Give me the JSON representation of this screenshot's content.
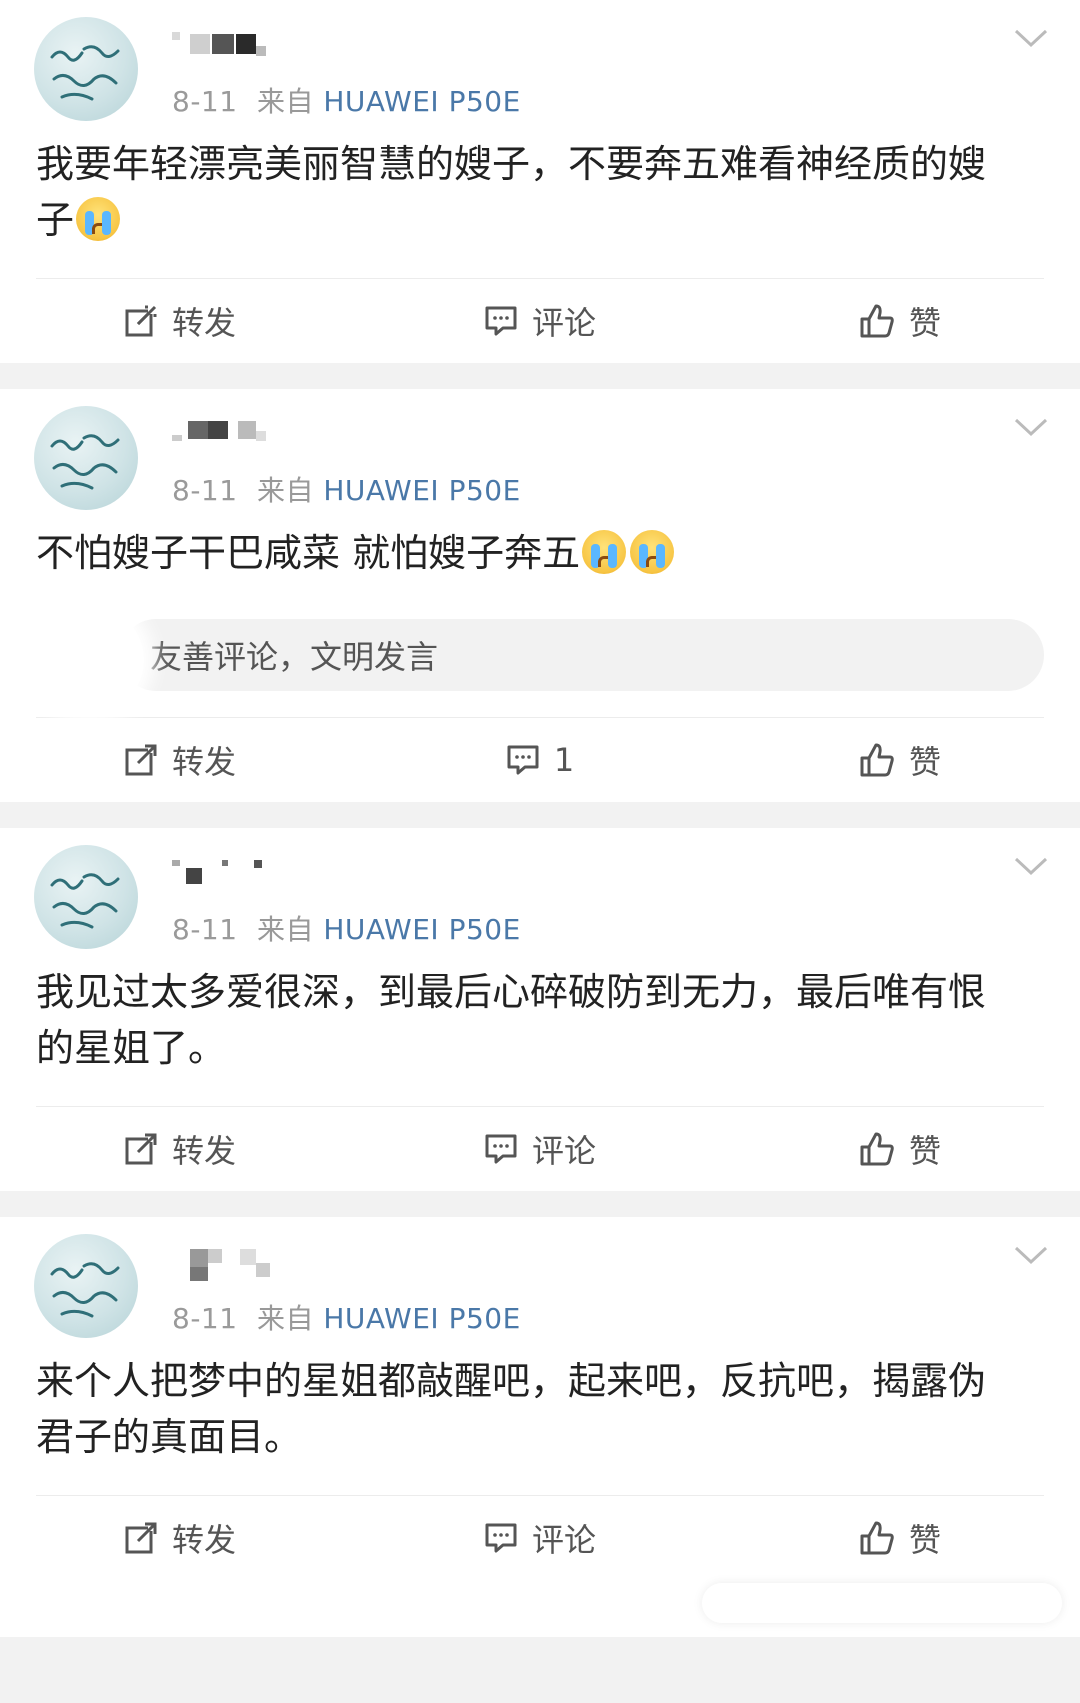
{
  "posts": [
    {
      "meta": {
        "date": "8-11",
        "via": "来自",
        "device": "HUAWEI P50E"
      },
      "content": [
        "我要年轻漂亮美丽智慧的嫂子，不要奔五难看神经质的嫂",
        "子"
      ],
      "emoji": [
        "crying-face-icon"
      ],
      "actions": {
        "repost": "转发",
        "comment": "评论",
        "like": "赞"
      }
    },
    {
      "meta": {
        "date": "8-11",
        "via": "来自",
        "device": "HUAWEI P50E"
      },
      "content": [
        "不怕嫂子干巴咸菜 就怕嫂子奔五"
      ],
      "emoji": [
        "crying-face-icon",
        "crying-face-icon"
      ],
      "comment_placeholder": "友善评论，文明发言",
      "actions": {
        "repost": "转发",
        "comment": "1",
        "like": "赞"
      }
    },
    {
      "meta": {
        "date": "8-11",
        "via": "来自",
        "device": "HUAWEI P50E"
      },
      "content": [
        "我见过太多爱很深，到最后心碎破防到无力，最后唯有恨",
        "的星姐了。"
      ],
      "actions": {
        "repost": "转发",
        "comment": "评论",
        "like": "赞"
      }
    },
    {
      "meta": {
        "date": "8-11",
        "via": "来自",
        "device": "HUAWEI P50E"
      },
      "content": [
        "来个人把梦中的星姐都敲醒吧，起来吧，反抗吧，揭露伪",
        "君子的真面目。"
      ],
      "actions": {
        "repost": "转发",
        "comment": "评论",
        "like": "赞"
      }
    }
  ],
  "colors": {
    "device_link": "#4a78a8",
    "meta_gray": "#9a9a9a",
    "avatar_teal": "#b4d2d6"
  },
  "icons": [
    "avatar-calligraphy",
    "chevron-down-icon",
    "repost-icon",
    "comment-icon",
    "like-icon",
    "crying-face-icon"
  ]
}
